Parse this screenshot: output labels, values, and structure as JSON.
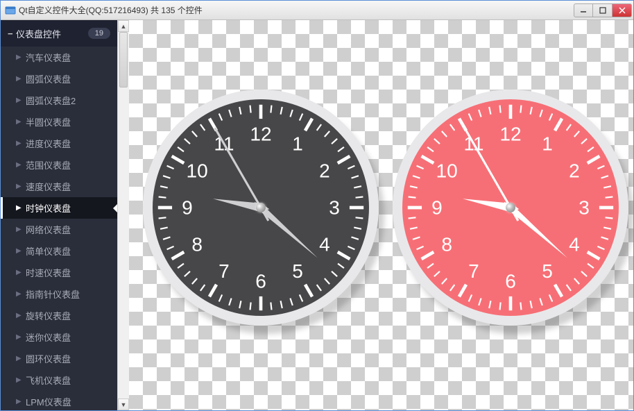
{
  "window": {
    "title": "Qt自定义控件大全(QQ:517216493) 共 135 个控件"
  },
  "sidebar": {
    "group_label": "仪表盘控件",
    "badge": "19",
    "items": [
      {
        "label": "汽车仪表盘",
        "selected": false
      },
      {
        "label": "圆弧仪表盘",
        "selected": false
      },
      {
        "label": "圆弧仪表盘2",
        "selected": false
      },
      {
        "label": "半圆仪表盘",
        "selected": false
      },
      {
        "label": "进度仪表盘",
        "selected": false
      },
      {
        "label": "范围仪表盘",
        "selected": false
      },
      {
        "label": "速度仪表盘",
        "selected": false
      },
      {
        "label": "时钟仪表盘",
        "selected": true
      },
      {
        "label": "网络仪表盘",
        "selected": false
      },
      {
        "label": "简单仪表盘",
        "selected": false
      },
      {
        "label": "时速仪表盘",
        "selected": false
      },
      {
        "label": "指南针仪表盘",
        "selected": false
      },
      {
        "label": "旋转仪表盘",
        "selected": false
      },
      {
        "label": "迷你仪表盘",
        "selected": false
      },
      {
        "label": "圆环仪表盘",
        "selected": false
      },
      {
        "label": "飞机仪表盘",
        "selected": false
      },
      {
        "label": "LPM仪表盘",
        "selected": false
      }
    ]
  },
  "clocks": [
    {
      "face_color": "#474749",
      "tick_color": "#ffffff",
      "number_color": "#ffffff",
      "hand_color": "#cfcfd1",
      "time": {
        "hour": 9,
        "minute": 21,
        "second": 55
      }
    },
    {
      "face_color": "#f76f76",
      "tick_color": "#ffffff",
      "number_color": "#ffffff",
      "hand_color": "#ffffff",
      "time": {
        "hour": 9,
        "minute": 21,
        "second": 55
      }
    }
  ],
  "numerals": [
    "12",
    "1",
    "2",
    "3",
    "4",
    "5",
    "6",
    "7",
    "8",
    "9",
    "10",
    "11"
  ]
}
